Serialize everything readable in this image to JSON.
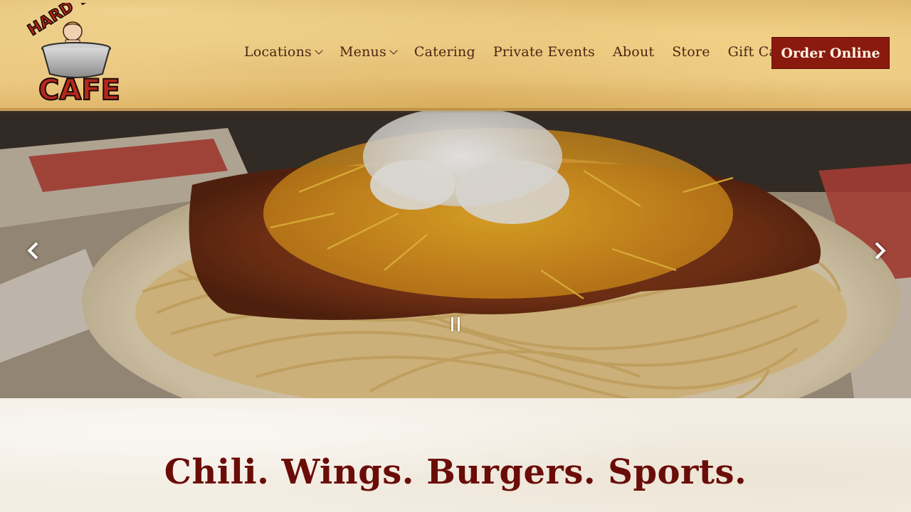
{
  "brand": {
    "logo_text_top": "HARD TIMES",
    "logo_text_bottom": "CAFE"
  },
  "nav": {
    "items": [
      {
        "label": "Locations",
        "has_dropdown": true
      },
      {
        "label": "Menus",
        "has_dropdown": true
      },
      {
        "label": "Catering",
        "has_dropdown": false
      },
      {
        "label": "Private Events",
        "has_dropdown": false
      },
      {
        "label": "About",
        "has_dropdown": false
      },
      {
        "label": "Store",
        "has_dropdown": false
      },
      {
        "label": "Gift Cards",
        "has_dropdown": true
      }
    ],
    "cta_label": "Order Online"
  },
  "hero": {
    "prev_icon": "chevron-left-icon",
    "next_icon": "chevron-right-icon",
    "pause_icon": "pause-icon"
  },
  "content": {
    "tagline": "Chili. Wings. Burgers. Sports."
  },
  "colors": {
    "accent": "#8b1a0e",
    "nav_text": "#4b2612",
    "tagline": "#6a0c08"
  }
}
